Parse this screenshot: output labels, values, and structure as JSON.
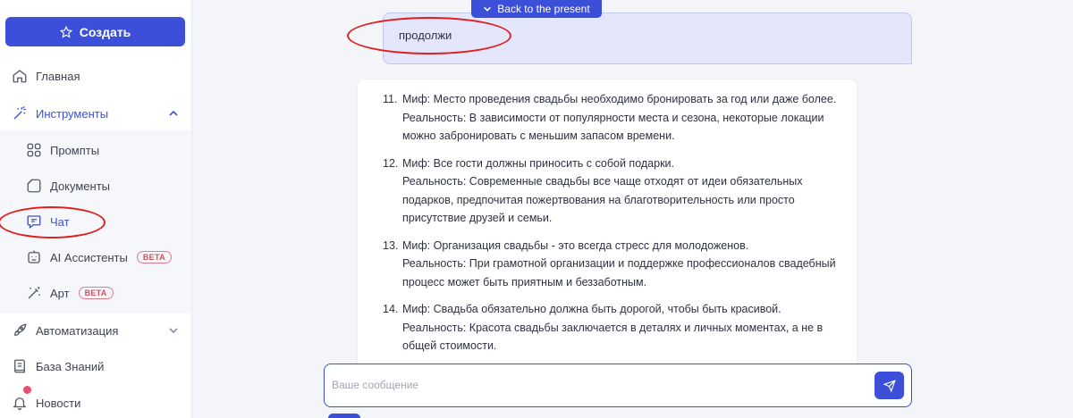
{
  "sidebar": {
    "create_label": "Создать",
    "items": [
      {
        "label": "Главная",
        "icon": "home-icon"
      },
      {
        "label": "Инструменты",
        "icon": "wand-icon"
      },
      {
        "label": "Промпты",
        "icon": "grid-icon"
      },
      {
        "label": "Документы",
        "icon": "document-icon"
      },
      {
        "label": "Чат",
        "icon": "chat-icon"
      },
      {
        "label": "AI Ассистенты",
        "icon": "robot-icon",
        "badge": "BETA"
      },
      {
        "label": "Арт",
        "icon": "magic-wand-icon",
        "badge": "BETA"
      },
      {
        "label": "Автоматизация",
        "icon": "rocket-icon"
      },
      {
        "label": "База Знаний",
        "icon": "book-icon"
      },
      {
        "label": "Новости",
        "icon": "bell-icon"
      }
    ]
  },
  "chat": {
    "back_label": "Back to the present",
    "user_message": "продолжи",
    "ai_items": [
      {
        "num": "11.",
        "myth": "Миф: Место проведения свадьбы необходимо бронировать за год или даже более.",
        "reality": "Реальность: В зависимости от популярности места и сезона, некоторые локации можно забронировать с меньшим запасом времени."
      },
      {
        "num": "12.",
        "myth": "Миф: Все гости должны приносить с собой подарки.",
        "reality": "Реальность: Современные свадьбы все чаще отходят от идеи обязательных подарков, предпочитая пожертвования на благотворительность или просто присутствие друзей и семьи."
      },
      {
        "num": "13.",
        "myth": "Миф: Организация свадьбы - это всегда стресс для молодоженов.",
        "reality": "Реальность: При грамотной организации и поддержке профессионалов свадебный процесс может быть приятным и беззаботным."
      },
      {
        "num": "14.",
        "myth": "Миф: Свадьба обязательно должна быть дорогой, чтобы быть красивой.",
        "reality": "Реальность: Красота свадьбы заключается в деталях и личных моментах, а не в общей стоимости."
      }
    ],
    "input_placeholder": "Ваше сообщение"
  },
  "colors": {
    "accent": "#3b4fd9",
    "annotation": "#e01e1e",
    "beta": "#d0505f"
  }
}
